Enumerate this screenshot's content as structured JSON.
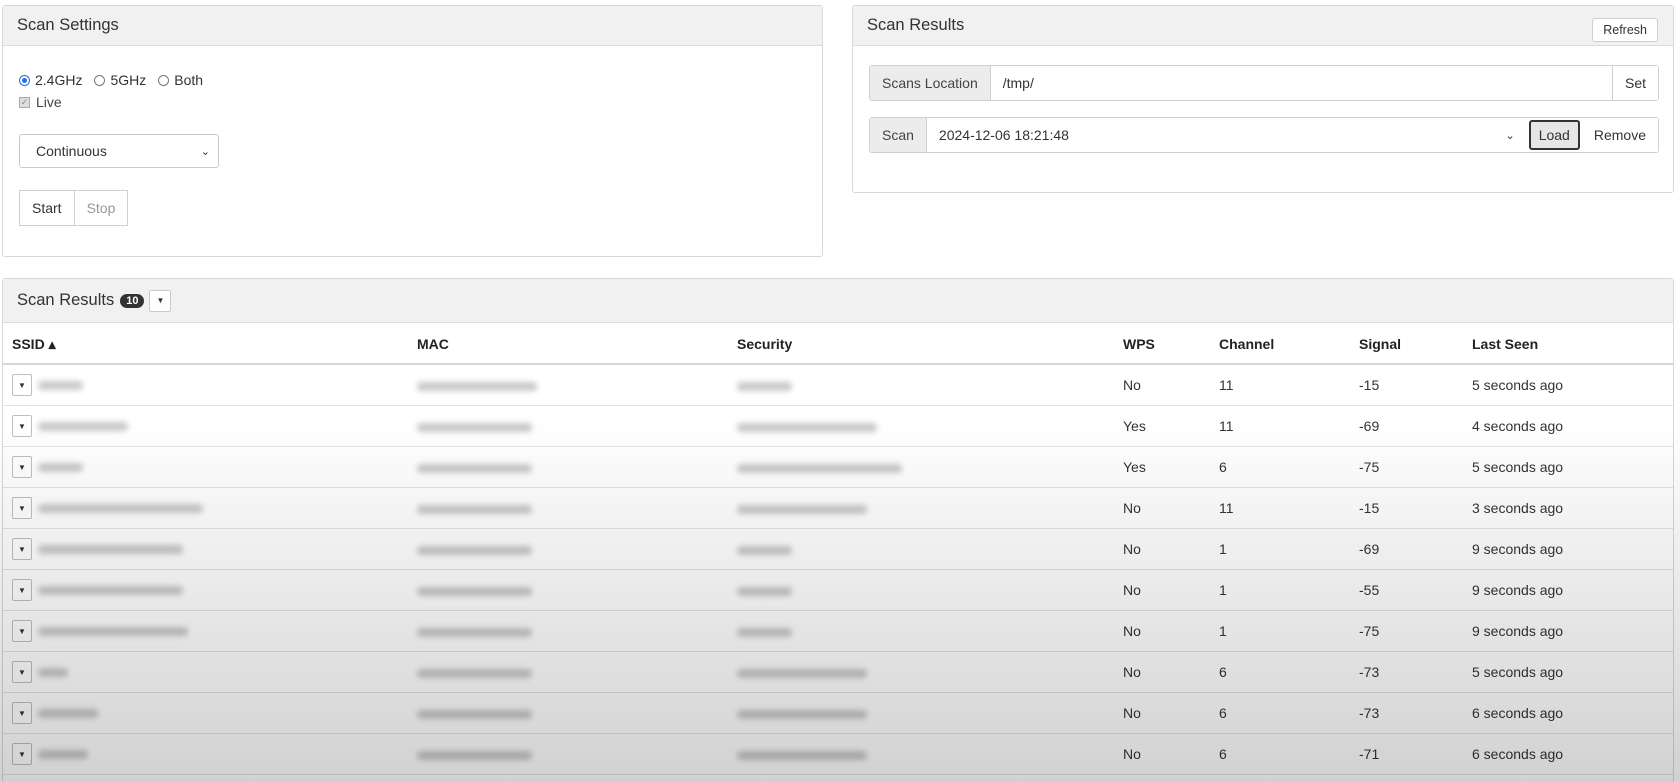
{
  "settings": {
    "title": "Scan Settings",
    "bands": [
      {
        "label": "2.4GHz",
        "checked": true
      },
      {
        "label": "5GHz",
        "checked": false
      },
      {
        "label": "Both",
        "checked": false
      }
    ],
    "live_label": "Live",
    "mode_value": "Continuous",
    "start_label": "Start",
    "stop_label": "Stop"
  },
  "results": {
    "title": "Scan Results",
    "refresh_label": "Refresh",
    "location_label": "Scans Location",
    "location_value": "/tmp/",
    "set_label": "Set",
    "scan_label": "Scan",
    "scan_value": "2024-12-06 18:21:48",
    "load_label": "Load",
    "remove_label": "Remove"
  },
  "table": {
    "title": "Scan Results",
    "count": "10",
    "columns": [
      "SSID ▴",
      "MAC",
      "Security",
      "WPS",
      "Channel",
      "Signal",
      "Last Seen"
    ],
    "rows": [
      {
        "wps": "No",
        "channel": "11",
        "signal": "-15",
        "last_seen": "5 seconds ago"
      },
      {
        "wps": "Yes",
        "channel": "11",
        "signal": "-69",
        "last_seen": "4 seconds ago"
      },
      {
        "wps": "Yes",
        "channel": "6",
        "signal": "-75",
        "last_seen": "5 seconds ago"
      },
      {
        "wps": "No",
        "channel": "11",
        "signal": "-15",
        "last_seen": "3 seconds ago"
      },
      {
        "wps": "No",
        "channel": "1",
        "signal": "-69",
        "last_seen": "9 seconds ago"
      },
      {
        "wps": "No",
        "channel": "1",
        "signal": "-55",
        "last_seen": "9 seconds ago"
      },
      {
        "wps": "No",
        "channel": "1",
        "signal": "-75",
        "last_seen": "9 seconds ago"
      },
      {
        "wps": "No",
        "channel": "6",
        "signal": "-73",
        "last_seen": "5 seconds ago"
      },
      {
        "wps": "No",
        "channel": "6",
        "signal": "-73",
        "last_seen": "6 seconds ago"
      },
      {
        "wps": "No",
        "channel": "6",
        "signal": "-71",
        "last_seen": "6 seconds ago"
      }
    ]
  }
}
